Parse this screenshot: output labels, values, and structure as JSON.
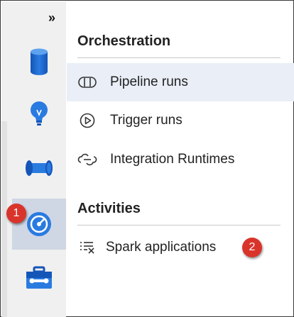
{
  "rail": {
    "expand_glyph": "»",
    "items": [
      {
        "icon": "database-icon"
      },
      {
        "icon": "lightbulb-icon"
      },
      {
        "icon": "pipe-icon"
      },
      {
        "icon": "monitor-gauge-icon",
        "active": true
      },
      {
        "icon": "toolbox-icon"
      }
    ]
  },
  "flyout": {
    "sections": [
      {
        "title": "Orchestration",
        "items": [
          {
            "label": "Pipeline runs",
            "icon": "pipeline-icon",
            "selected": true
          },
          {
            "label": "Trigger runs",
            "icon": "play-circle-icon"
          },
          {
            "label": "Integration Runtimes",
            "icon": "cloud-link-icon"
          }
        ]
      },
      {
        "title": "Activities",
        "items": [
          {
            "label": "Spark applications",
            "icon": "list-x-icon"
          }
        ]
      }
    ]
  },
  "callouts": [
    "1",
    "2"
  ],
  "colors": {
    "rail_bg": "#f0f0f0",
    "active_bg": "#cfd6e4",
    "selected_bg": "#e9eef7",
    "icon_blue": "#1f6fd1",
    "badge_red": "#d9342b"
  }
}
